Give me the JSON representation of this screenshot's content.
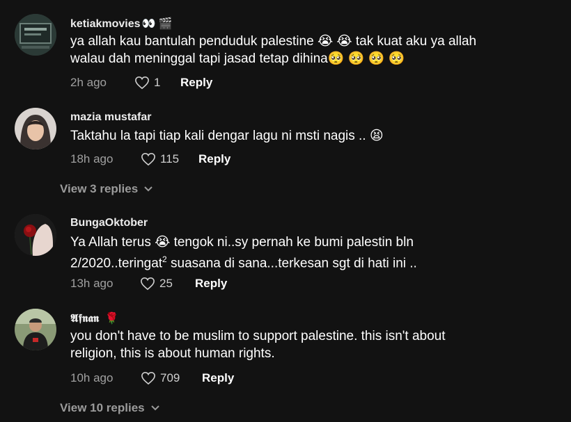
{
  "comments": [
    {
      "username": "ketiakmovies",
      "username_emojis": "👀 🎬",
      "lines": [
        "ya allah kau bantulah penduduk palestine 😭 😭  tak kuat aku ya allah",
        "walau dah meninggal tapi jasad tetap dihina🥺 🥺 🥺 🥺"
      ],
      "time": "2h ago",
      "likes": "1",
      "reply_label": "Reply"
    },
    {
      "username": "mazia mustafar",
      "lines": [
        "Taktahu la tapi tiap kali dengar lagu ni msti nagis .. 😫"
      ],
      "time": "18h ago",
      "likes": "115",
      "reply_label": "Reply",
      "view_replies": "View 3 replies"
    },
    {
      "username": "BungaOktober",
      "lines": [
        "Ya Allah terus 😭  tengok ni..sy pernah ke bumi palestin bln",
        "2/2020..teringat",
        "suasana di sana...terkesan sgt di hati ini .."
      ],
      "superscript": "2",
      "time": "13h ago",
      "likes": "25",
      "reply_label": "Reply"
    },
    {
      "username": "𝕬𝖋𝖓𝖆𝖓",
      "username_emojis": "🌹",
      "lines": [
        "you don't have to be muslim to support palestine. this isn't about",
        "religion, this is about human rights."
      ],
      "time": "10h ago",
      "likes": "709",
      "reply_label": "Reply",
      "view_replies": "View 10 replies"
    }
  ],
  "colors": {
    "background": "#121212",
    "text": "#ffffff",
    "muted": "#a0a0a0"
  }
}
